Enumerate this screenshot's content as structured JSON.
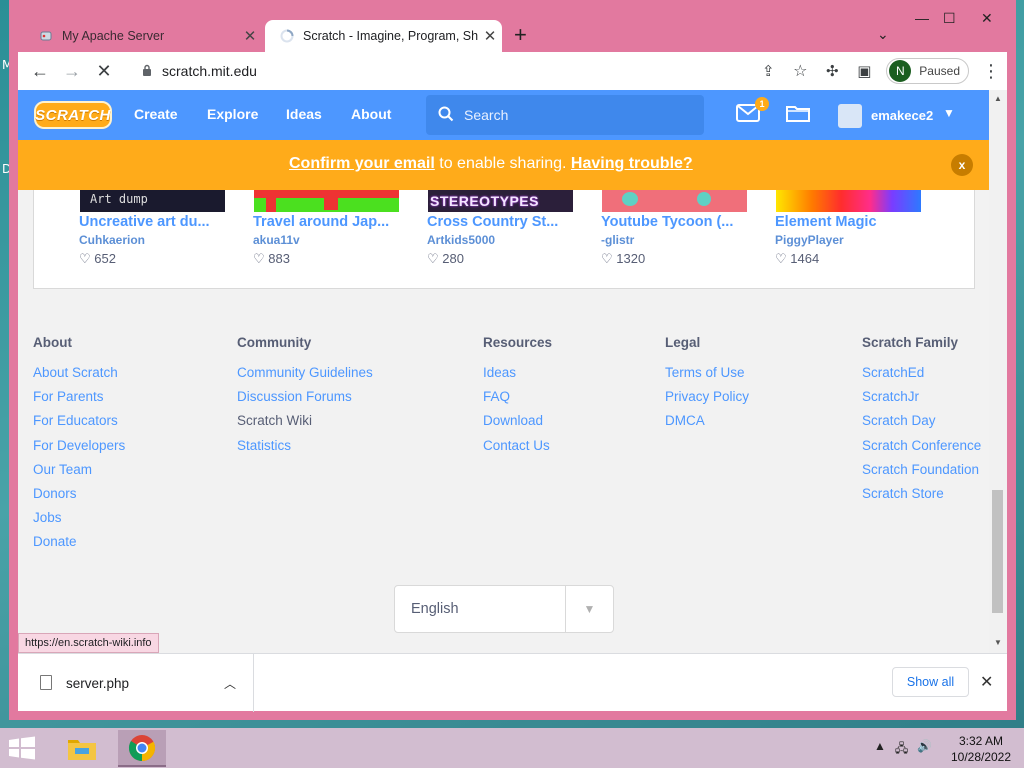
{
  "desktop": {
    "letters": [
      "M",
      "D"
    ]
  },
  "browser": {
    "tabs": [
      {
        "title": "My Apache Server",
        "active": false
      },
      {
        "title": "Scratch - Imagine, Program, Share",
        "active": true
      }
    ],
    "new_tab": "+",
    "url": "scratch.mit.edu",
    "profile": {
      "initial": "N",
      "status": "Paused"
    }
  },
  "scratch": {
    "logo": "SCRATCH",
    "nav": [
      "Create",
      "Explore",
      "Ideas",
      "About"
    ],
    "search_placeholder": "Search",
    "messages_count": "1",
    "username": "emakece2",
    "banner": {
      "link1": "Confirm your email",
      "middle": " to enable sharing. ",
      "link2": "Having trouble?",
      "close": "x"
    },
    "projects": [
      {
        "title": "Uncreative art du...",
        "author": "Cuhkaerion",
        "loves": "652",
        "thumb_text": "Art dump",
        "thumb_color": "#1a1a2e"
      },
      {
        "title": "Travel around Jap...",
        "author": "akua11v",
        "loves": "883",
        "thumb_text": "",
        "thumb_color": "#4be01f"
      },
      {
        "title": "Cross Country St...",
        "author": "Artkids5000",
        "loves": "280",
        "thumb_text": "STEREOTYPES",
        "thumb_color": "#2b1f3a"
      },
      {
        "title": "Youtube Tycoon (...",
        "author": "-glistr",
        "loves": "1320",
        "thumb_text": "",
        "thumb_color": "#f06f7a"
      },
      {
        "title": "Element Magic",
        "author": "PiggyPlayer",
        "loves": "1464",
        "thumb_text": "",
        "thumb_color": "#ff3b30"
      }
    ],
    "footer": {
      "about": {
        "heading": "About",
        "links": [
          "About Scratch",
          "For Parents",
          "For Educators",
          "For Developers",
          "Our Team",
          "Donors",
          "Jobs",
          "Donate"
        ]
      },
      "community": {
        "heading": "Community",
        "links": [
          "Community Guidelines",
          "Discussion Forums",
          "Scratch Wiki",
          "Statistics"
        ]
      },
      "resources": {
        "heading": "Resources",
        "links": [
          "Ideas",
          "FAQ",
          "Download",
          "Contact Us"
        ]
      },
      "legal": {
        "heading": "Legal",
        "links": [
          "Terms of Use",
          "Privacy Policy",
          "DMCA"
        ]
      },
      "family": {
        "heading": "Scratch Family",
        "links": [
          "ScratchEd",
          "ScratchJr",
          "Scratch Day",
          "Scratch Conference",
          "Scratch Foundation",
          "Scratch Store"
        ]
      }
    },
    "language": "English"
  },
  "status_url": "https://en.scratch-wiki.info",
  "downloads": {
    "file": "server.php",
    "show_all": "Show all"
  },
  "taskbar": {
    "time": "3:32 AM",
    "date": "10/28/2022"
  },
  "colors": {
    "scratch_blue": "#4d97ff",
    "banner_orange": "#ffab1a",
    "frame_pink": "#e2799f"
  }
}
